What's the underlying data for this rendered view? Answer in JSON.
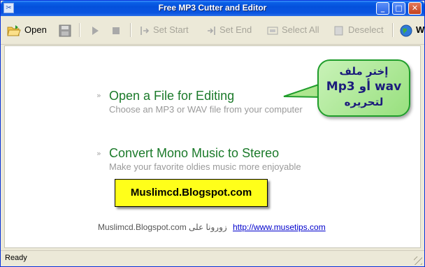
{
  "window": {
    "title": "Free MP3 Cutter and Editor",
    "app_icon_glyph": "✂",
    "controls": {
      "minimize": "_",
      "maximize": "□",
      "close": "✕"
    }
  },
  "toolbar": {
    "open": "Open",
    "set_start": "Set Start",
    "set_end": "Set End",
    "select_all": "Select All",
    "deselect": "Deselect",
    "web_partial": "W"
  },
  "tasks": [
    {
      "title": "Open a File for Editing",
      "subtitle": "Choose an MP3 or WAV file from your computer"
    },
    {
      "title": "Convert Mono Music to Stereo",
      "subtitle": "Make your favorite oldies music more enjoyable"
    }
  ],
  "callout": {
    "line1": "إختر ملف",
    "line2": "wav أو Mp3",
    "line3": "لتحريره"
  },
  "yellow_box": "Muslimcd.Blogspot.com",
  "footer": {
    "text": "Muslimcd.Blogspot.com زورونا على",
    "link": "http://www.musetips.com"
  },
  "status": "Ready",
  "colors": {
    "title_blue": "#0450dc",
    "task_green": "#1b7a2a",
    "callout_border": "#1f9d2b",
    "yellow": "#ffff1a",
    "link": "#0000cc"
  }
}
